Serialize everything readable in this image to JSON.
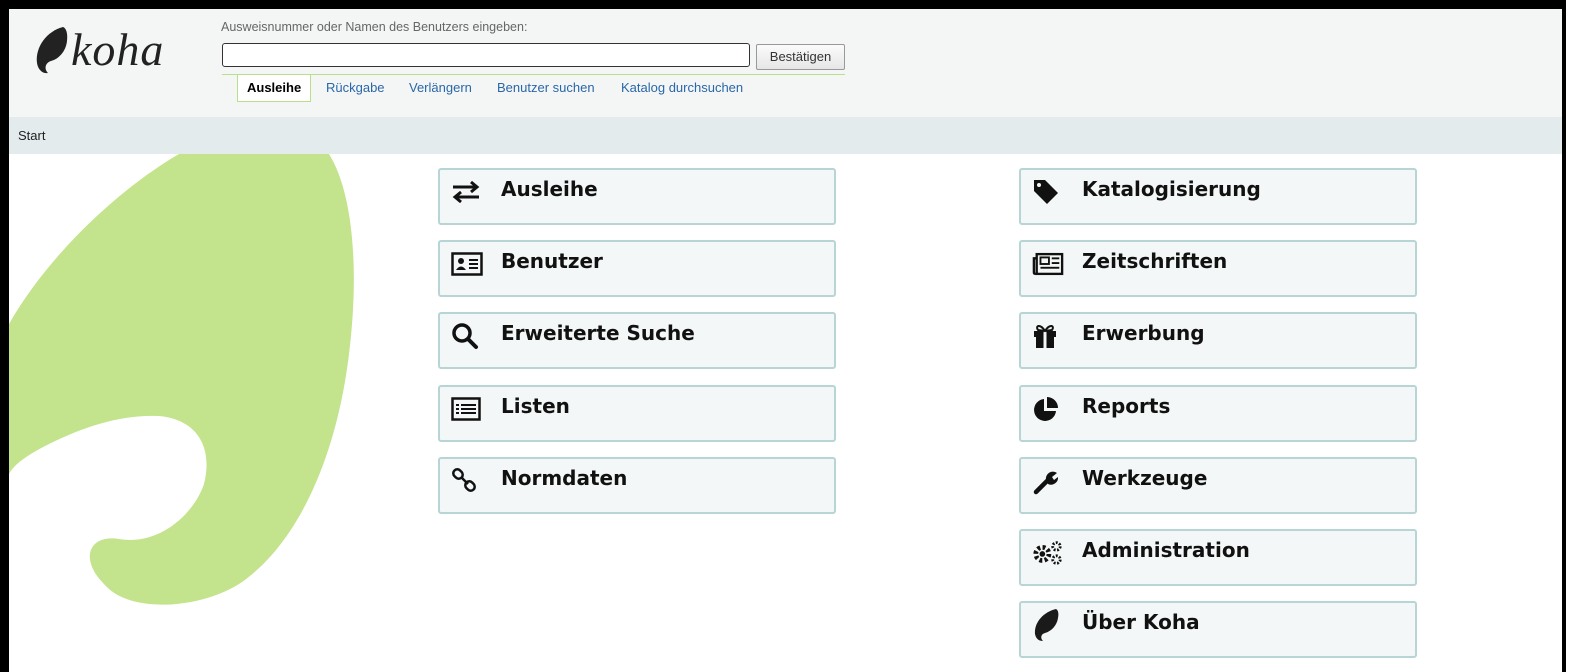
{
  "header": {
    "logo_text": "koha",
    "search_label": "Ausweisnummer oder Namen des Benutzers eingeben:",
    "search_value": "",
    "submit_label": "Bestätigen",
    "tabs": [
      {
        "label": "Ausleihe",
        "active": true
      },
      {
        "label": "Rückgabe"
      },
      {
        "label": "Verlängern"
      },
      {
        "label": "Benutzer suchen"
      },
      {
        "label": "Katalog durchsuchen"
      }
    ]
  },
  "breadcrumb": "Start",
  "modules_left": [
    {
      "label": "Ausleihe",
      "icon": "exchange-arrows-icon"
    },
    {
      "label": "Benutzer",
      "icon": "id-card-icon"
    },
    {
      "label": "Erweiterte Suche",
      "icon": "search-icon"
    },
    {
      "label": "Listen",
      "icon": "list-icon"
    },
    {
      "label": "Normdaten",
      "icon": "link-chain-icon"
    }
  ],
  "modules_right": [
    {
      "label": "Katalogisierung",
      "icon": "tag-icon"
    },
    {
      "label": "Zeitschriften",
      "icon": "newspaper-icon"
    },
    {
      "label": "Erwerbung",
      "icon": "gift-icon"
    },
    {
      "label": "Reports",
      "icon": "pie-chart-icon"
    },
    {
      "label": "Werkzeuge",
      "icon": "wrench-icon"
    },
    {
      "label": "Administration",
      "icon": "gears-icon"
    },
    {
      "label": "Über Koha",
      "icon": "koha-leaf-icon"
    }
  ],
  "colors": {
    "accent_green": "#c3e38c",
    "link_blue": "#2a67a8",
    "tile_border": "#b7d5d5"
  }
}
